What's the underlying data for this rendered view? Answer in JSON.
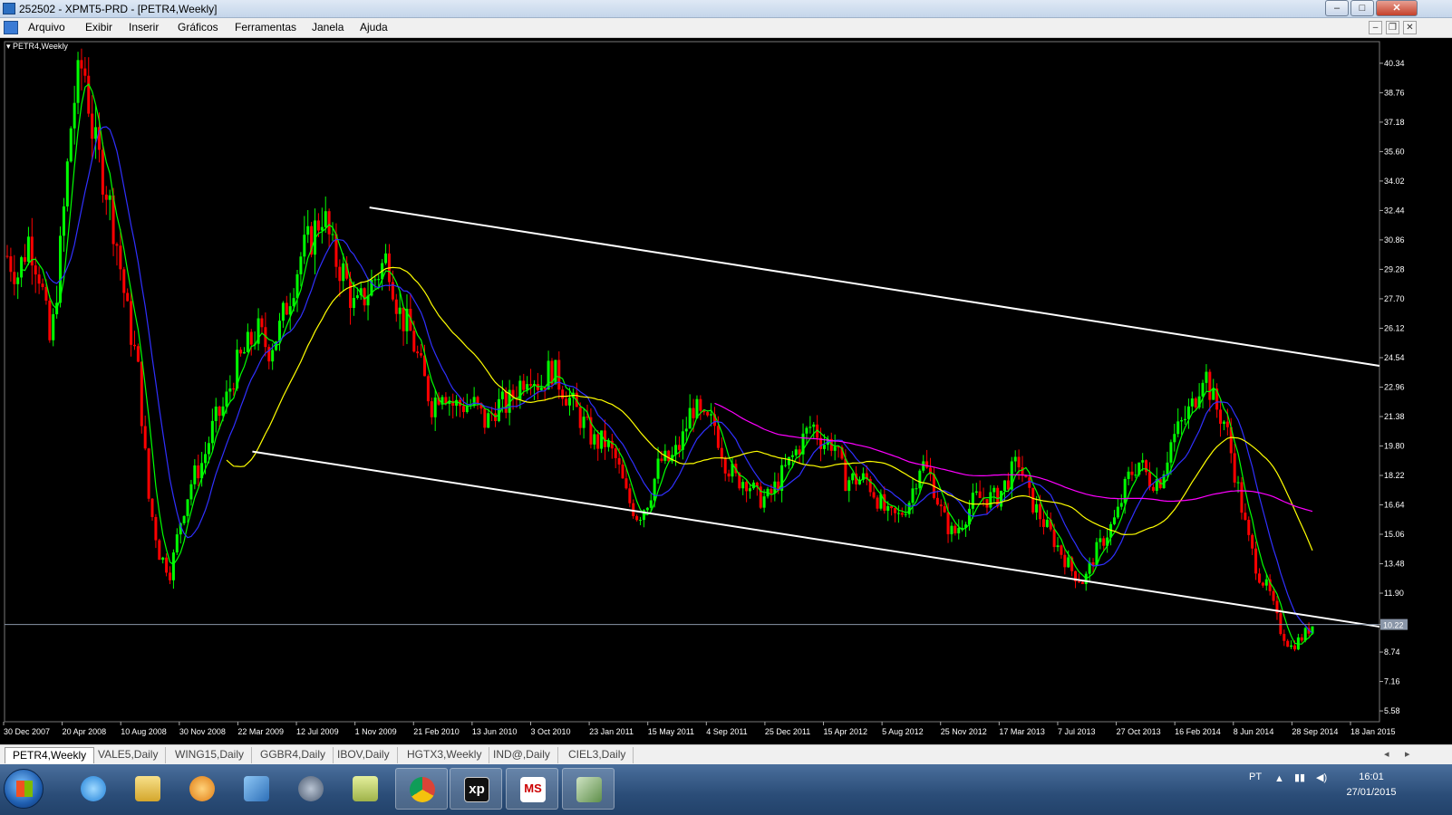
{
  "window": {
    "title": "252502 - XPMT5-PRD - [PETR4,Weekly]",
    "minimize": "‒",
    "maximize": "□",
    "close": "✕"
  },
  "menu": [
    "Arquivo",
    "Exibir",
    "Inserir",
    "Gráficos",
    "Ferramentas",
    "Janela",
    "Ajuda"
  ],
  "mdi_buttons": [
    "–",
    "❐",
    "✕"
  ],
  "chart_label": "PETR4,Weekly",
  "chart_data": {
    "type": "candlestick",
    "symbol": "PETR4",
    "timeframe": "Weekly",
    "background": "#000000",
    "up_color": "#00ff00",
    "down_color": "#ff0000",
    "y_ticks": [
      "40.34",
      "38.76",
      "37.18",
      "35.60",
      "34.02",
      "32.44",
      "30.86",
      "29.28",
      "27.70",
      "26.12",
      "24.54",
      "22.96",
      "21.38",
      "19.80",
      "18.22",
      "16.64",
      "15.06",
      "13.48",
      "11.90",
      "10.22",
      "8.74",
      "7.16",
      "5.58"
    ],
    "x_ticks": [
      "30 Dec 2007",
      "20 Apr 2008",
      "10 Aug 2008",
      "30 Nov 2008",
      "22 Mar 2009",
      "12 Jul 2009",
      "1 Nov 2009",
      "21 Feb 2010",
      "13 Jun 2010",
      "3 Oct 2010",
      "23 Jan 2011",
      "15 May 2011",
      "4 Sep 2011",
      "25 Dec 2011",
      "15 Apr 2012",
      "5 Aug 2012",
      "25 Nov 2012",
      "17 Mar 2013",
      "7 Jul 2013",
      "27 Oct 2013",
      "16 Feb 2014",
      "8 Jun 2014",
      "28 Sep 2014",
      "18 Jan 2015"
    ],
    "current_price": "10.22",
    "ylim": [
      5.0,
      41.5
    ],
    "price_path": [
      [
        0,
        30
      ],
      [
        1,
        29
      ],
      [
        2,
        31
      ],
      [
        3,
        29
      ],
      [
        4,
        25
      ],
      [
        5,
        31
      ],
      [
        6,
        38
      ],
      [
        7,
        40.5
      ],
      [
        8,
        36
      ],
      [
        9,
        34
      ],
      [
        10,
        31
      ],
      [
        11,
        27
      ],
      [
        12,
        24
      ],
      [
        13,
        17
      ],
      [
        14,
        14
      ],
      [
        15,
        13
      ],
      [
        16,
        16
      ],
      [
        17,
        18
      ],
      [
        18,
        19
      ],
      [
        19,
        21
      ],
      [
        20,
        22
      ],
      [
        21,
        24
      ],
      [
        22,
        25
      ],
      [
        23,
        26
      ],
      [
        24,
        25
      ],
      [
        25,
        26
      ],
      [
        26,
        28
      ],
      [
        27,
        30
      ],
      [
        28,
        31
      ],
      [
        29,
        32.4
      ],
      [
        30,
        30
      ],
      [
        31,
        29
      ],
      [
        32,
        27
      ],
      [
        33,
        28
      ],
      [
        34,
        29
      ],
      [
        35,
        30
      ],
      [
        36,
        27
      ],
      [
        37,
        26
      ],
      [
        38,
        24
      ],
      [
        39,
        22
      ],
      [
        40,
        23
      ],
      [
        41,
        22
      ],
      [
        42,
        22
      ],
      [
        43,
        22
      ],
      [
        44,
        21
      ],
      [
        45,
        22
      ],
      [
        46,
        22
      ],
      [
        47,
        23
      ],
      [
        48,
        24
      ],
      [
        49,
        23
      ],
      [
        50,
        24
      ],
      [
        51,
        23
      ],
      [
        52,
        22
      ],
      [
        53,
        21
      ],
      [
        54,
        20
      ],
      [
        55,
        20
      ],
      [
        56,
        19
      ],
      [
        57,
        17
      ],
      [
        58,
        16
      ],
      [
        59,
        17
      ],
      [
        60,
        19
      ],
      [
        61,
        19
      ],
      [
        62,
        20
      ],
      [
        63,
        22
      ],
      [
        64,
        21
      ],
      [
        65,
        21
      ],
      [
        66,
        19
      ],
      [
        67,
        18
      ],
      [
        68,
        18
      ],
      [
        69,
        17
      ],
      [
        70,
        17
      ],
      [
        71,
        18
      ],
      [
        72,
        19
      ],
      [
        73,
        20
      ],
      [
        74,
        21
      ],
      [
        75,
        20
      ],
      [
        76,
        20
      ],
      [
        77,
        18
      ],
      [
        78,
        18
      ],
      [
        79,
        18
      ],
      [
        80,
        17
      ],
      [
        81,
        16
      ],
      [
        82,
        16
      ],
      [
        83,
        17
      ],
      [
        84,
        19
      ],
      [
        85,
        18
      ],
      [
        86,
        16
      ],
      [
        87,
        15
      ],
      [
        88,
        16
      ],
      [
        89,
        17
      ],
      [
        90,
        17
      ],
      [
        91,
        17
      ],
      [
        92,
        18
      ],
      [
        93,
        19
      ],
      [
        94,
        17
      ],
      [
        95,
        16
      ],
      [
        96,
        15
      ],
      [
        97,
        14
      ],
      [
        98,
        13
      ],
      [
        99,
        12.5
      ],
      [
        100,
        14
      ],
      [
        101,
        15
      ],
      [
        102,
        16
      ],
      [
        103,
        18
      ],
      [
        104,
        19
      ],
      [
        105,
        18
      ],
      [
        106,
        18
      ],
      [
        107,
        20
      ],
      [
        108,
        21
      ],
      [
        109,
        22
      ],
      [
        110,
        24
      ],
      [
        111,
        22
      ],
      [
        112,
        21
      ],
      [
        113,
        18
      ],
      [
        114,
        15
      ],
      [
        115,
        13
      ],
      [
        116,
        12
      ],
      [
        117,
        10
      ],
      [
        118,
        9
      ],
      [
        119,
        9.5
      ],
      [
        120,
        10.2
      ]
    ],
    "series": [
      {
        "name": "",
        "color": "#00ff00",
        "type": "ma_fast"
      },
      {
        "name": "",
        "color": "#3030ff",
        "type": "ma_mid"
      },
      {
        "name": "",
        "color": "#ffff00",
        "type": "ma_slow"
      },
      {
        "name": "",
        "color": "#ff00ff",
        "type": "ma_long"
      }
    ],
    "trend_lines": [
      {
        "from": [
          "1 Nov 2009",
          32.6
        ],
        "to": [
          "18 Jan 2015",
          24.1
        ],
        "color": "#ffffff"
      },
      {
        "from": [
          "22 Mar 2009",
          19.5
        ],
        "to": [
          "18 Jan 2015",
          10.1
        ],
        "color": "#ffffff"
      }
    ]
  },
  "tabs": [
    "PETR4,Weekly",
    "VALE5,Daily",
    "WING15,Daily",
    "GGBR4,Daily",
    "IBOV,Daily",
    "HGTX3,Weekly",
    "IND@,Daily",
    "CIEL3,Daily"
  ],
  "tab_nav": [
    "◂",
    "▸"
  ],
  "taskbar": {
    "apps": [
      "internet-explorer",
      "file-explorer",
      "media-player",
      "outlook",
      "hp",
      "metatrader-folder",
      "chrome",
      "xp",
      "ms-trader",
      "metatrader"
    ],
    "xp_label": "xp",
    "ms_label": "MS",
    "language": "PT",
    "time": "16:01",
    "date": "27/01/2015"
  }
}
